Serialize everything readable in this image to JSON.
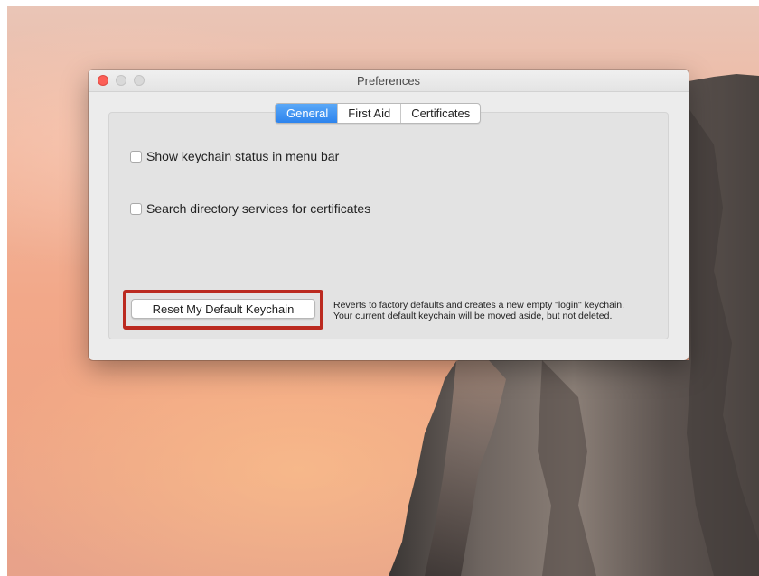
{
  "window": {
    "title": "Preferences"
  },
  "tabs": [
    {
      "label": "General",
      "active": true
    },
    {
      "label": "First Aid",
      "active": false
    },
    {
      "label": "Certificates",
      "active": false
    }
  ],
  "options": {
    "show_status": {
      "label": "Show keychain status in menu bar",
      "checked": false
    },
    "search_directory": {
      "label": "Search directory services for certificates",
      "checked": false
    }
  },
  "reset": {
    "button_label": "Reset My Default Keychain",
    "description_line1": "Reverts to factory defaults and creates a new empty \"login\" keychain.",
    "description_line2": "Your current default keychain will be moved aside, but not deleted."
  },
  "colors": {
    "accent": "#2d84ee",
    "highlight_outline": "#bb2a20",
    "close_button": "#fc5f57"
  }
}
